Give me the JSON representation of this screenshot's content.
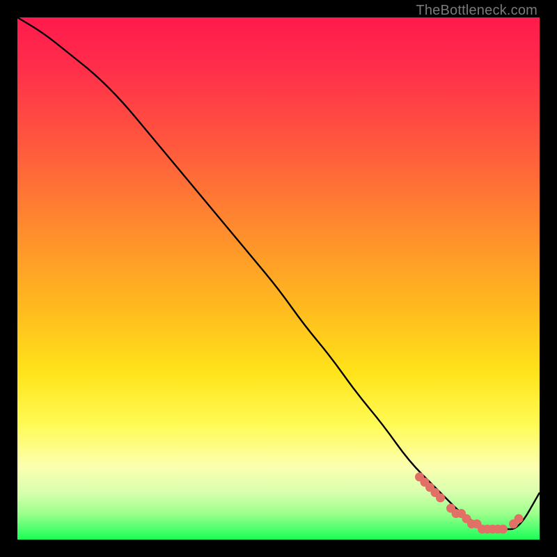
{
  "watermark": "TheBottleneck.com",
  "colors": {
    "curve_stroke": "#000000",
    "marker_fill": "#e27066",
    "background_black": "#000000"
  },
  "chart_data": {
    "type": "line",
    "title": "",
    "xlabel": "",
    "ylabel": "",
    "xlim": [
      0,
      100
    ],
    "ylim": [
      0,
      100
    ],
    "series": [
      {
        "name": "curve",
        "x": [
          0,
          5,
          10,
          15,
          20,
          25,
          30,
          35,
          40,
          45,
          50,
          55,
          60,
          65,
          70,
          75,
          80,
          82,
          85,
          88,
          90,
          93,
          96,
          100
        ],
        "y": [
          100,
          97,
          93,
          89,
          84,
          78,
          72,
          66,
          60,
          54,
          48,
          41,
          35,
          28,
          22,
          15,
          10,
          8,
          5,
          3,
          2,
          2,
          2,
          9
        ]
      }
    ],
    "markers": {
      "name": "highlight-dots",
      "x": [
        77,
        78,
        79,
        80,
        81,
        83,
        84,
        85,
        86,
        87,
        88,
        89,
        90,
        91,
        92,
        93,
        95,
        96
      ],
      "y": [
        12,
        11,
        10,
        9,
        8,
        6,
        5,
        5,
        4,
        3,
        3,
        2,
        2,
        2,
        2,
        2,
        3,
        4
      ]
    }
  }
}
